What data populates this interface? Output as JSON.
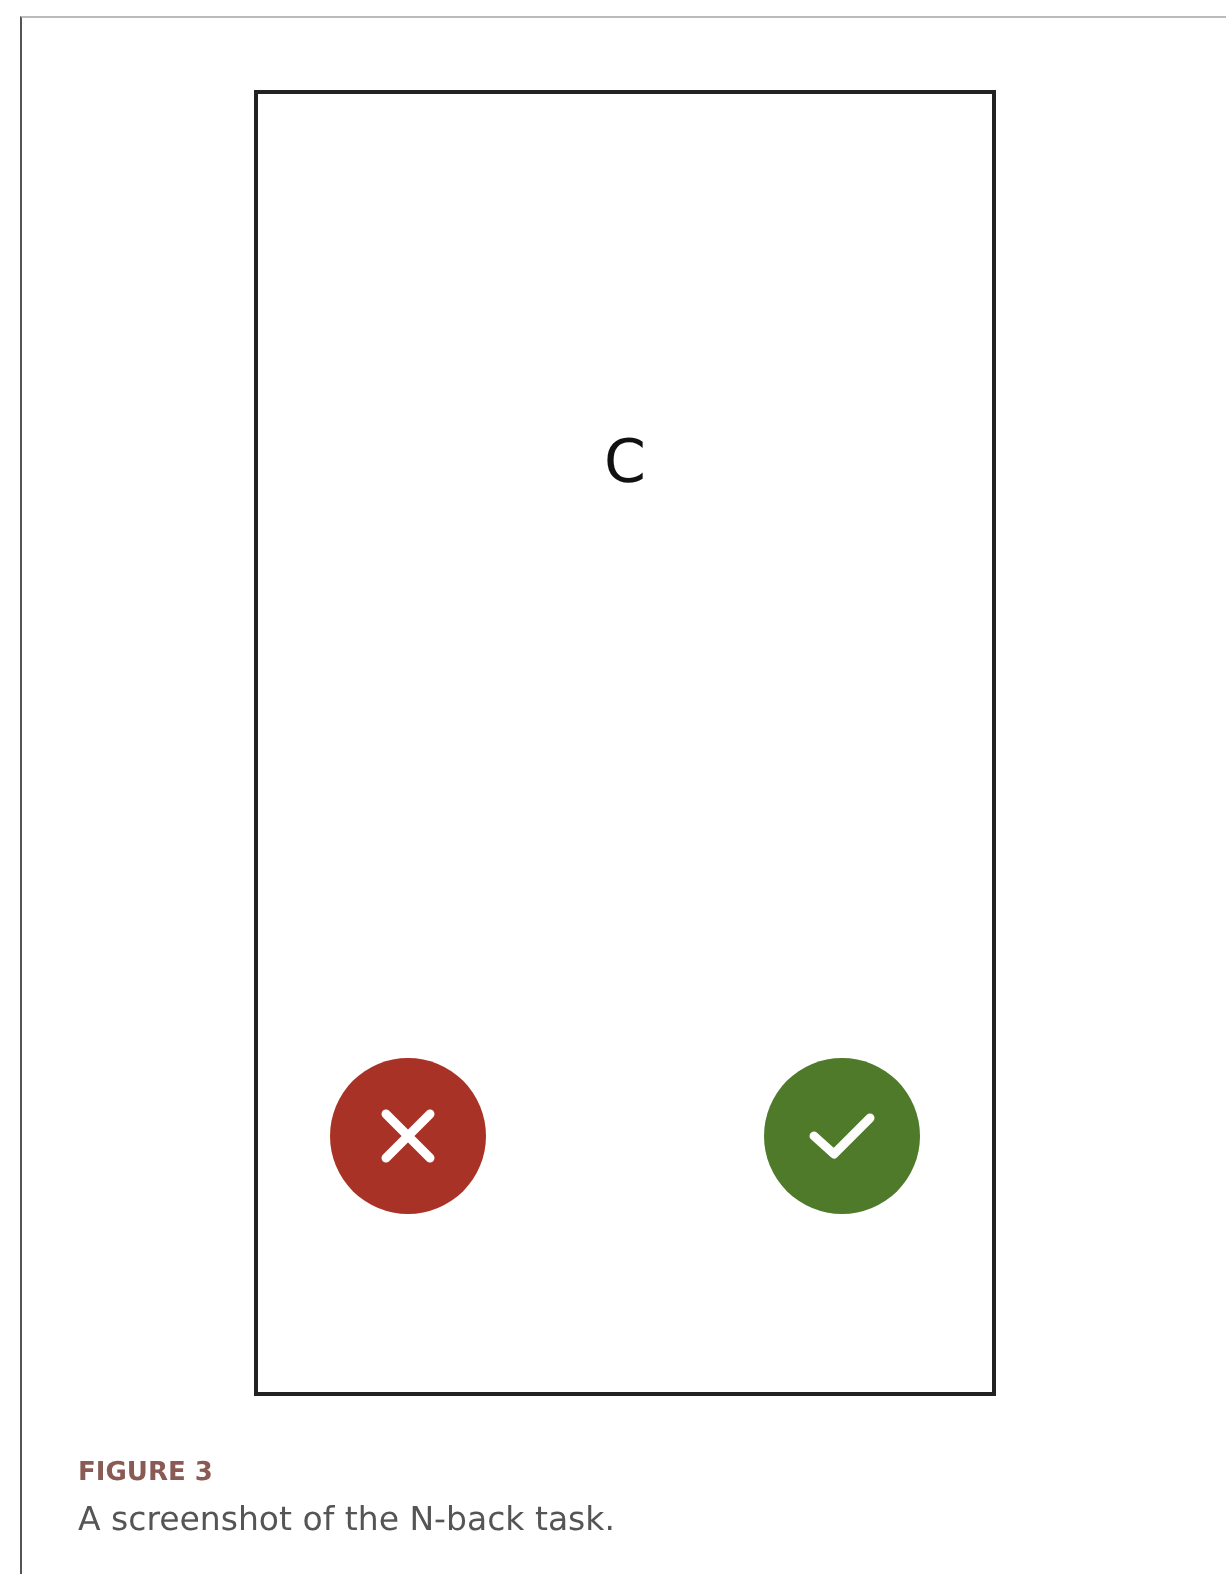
{
  "task_screen": {
    "stimulus": "C",
    "buttons": [
      {
        "kind": "reject"
      },
      {
        "kind": "accept"
      }
    ]
  },
  "figure_label": "FIGURE 3",
  "caption": "A screenshot of the N-back task."
}
